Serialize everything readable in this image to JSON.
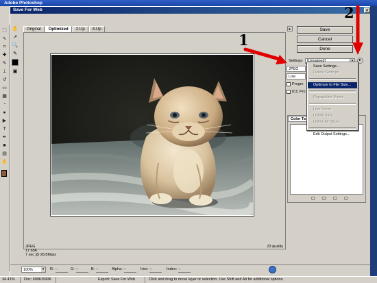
{
  "app": {
    "title": "Adobe Photoshop"
  },
  "dialog": {
    "title": "Save For Web",
    "close_glyph": "×",
    "tabs": [
      {
        "label": "Original"
      },
      {
        "label": "Optimized"
      },
      {
        "label": "2-Up"
      },
      {
        "label": "4-Up"
      }
    ],
    "tab_menu_glyph": "▸"
  },
  "buttons": {
    "save": "Save",
    "cancel": "Cancel",
    "done": "Done"
  },
  "settings": {
    "label": "Settings:",
    "value": "[Unnamed]",
    "format_value": "JPEG",
    "quality_value": "Low",
    "progressive_label": "Progre",
    "icc_label": "ICC Pro",
    "menu_glyph": "▸"
  },
  "settings_menu": {
    "items": [
      {
        "label": "Save Settings...",
        "state": "enabled"
      },
      {
        "label": "Delete Settings",
        "state": "disabled"
      },
      {
        "label": "Optimize to File Size...",
        "state": "highlighted"
      },
      {
        "label": "Repopulate Views",
        "state": "disabled"
      },
      {
        "label": "Link Slices",
        "state": "disabled"
      },
      {
        "label": "Unlink Slice",
        "state": "disabled"
      },
      {
        "label": "Unlink All Slices",
        "state": "disabled"
      },
      {
        "label": "Edit Output Settings...",
        "state": "enabled"
      }
    ]
  },
  "color_table": {
    "tab_label": "Color Ta"
  },
  "preview_info": {
    "format": "JPEG",
    "size": "17.65K",
    "download_time": "7 sec @ 28.8Kbps",
    "quality": "23 quality"
  },
  "bottom_bar": {
    "zoom": "100%",
    "readouts": [
      {
        "label": "R:",
        "value": "--"
      },
      {
        "label": "G:",
        "value": "--"
      },
      {
        "label": "B:",
        "value": "--"
      },
      {
        "label": "Alpha:",
        "value": "--"
      },
      {
        "label": "Hex:",
        "value": "--"
      },
      {
        "label": "Index:",
        "value": "--"
      }
    ]
  },
  "status_bar": {
    "zoom": "34.41%",
    "doc": "Doc: 690K/690K",
    "export": "Export: Save For Web",
    "hint": "Click and drag to move layer or selection. Use Shift and Alt for additional options."
  },
  "annotations": [
    {
      "number": "1",
      "color": "#e00000"
    },
    {
      "number": "2",
      "color": "#e00000"
    }
  ],
  "colors": {
    "dialog_bg": "#d4d0c8",
    "titlebar": "#0a246a",
    "menu_highlight": "#0a246a",
    "annotation_red": "#e00000",
    "desktop": "#3a6ea5"
  },
  "icons": {
    "tools": [
      "hand-tool-icon",
      "slice-select-icon",
      "zoom-tool-icon",
      "eyedropper-icon",
      "eyedropper-color-icon",
      "toggle-slices-icon"
    ],
    "color_table_buttons": [
      "lock-color-icon",
      "new-color-icon",
      "delete-color-icon",
      "table-menu-icon"
    ]
  }
}
